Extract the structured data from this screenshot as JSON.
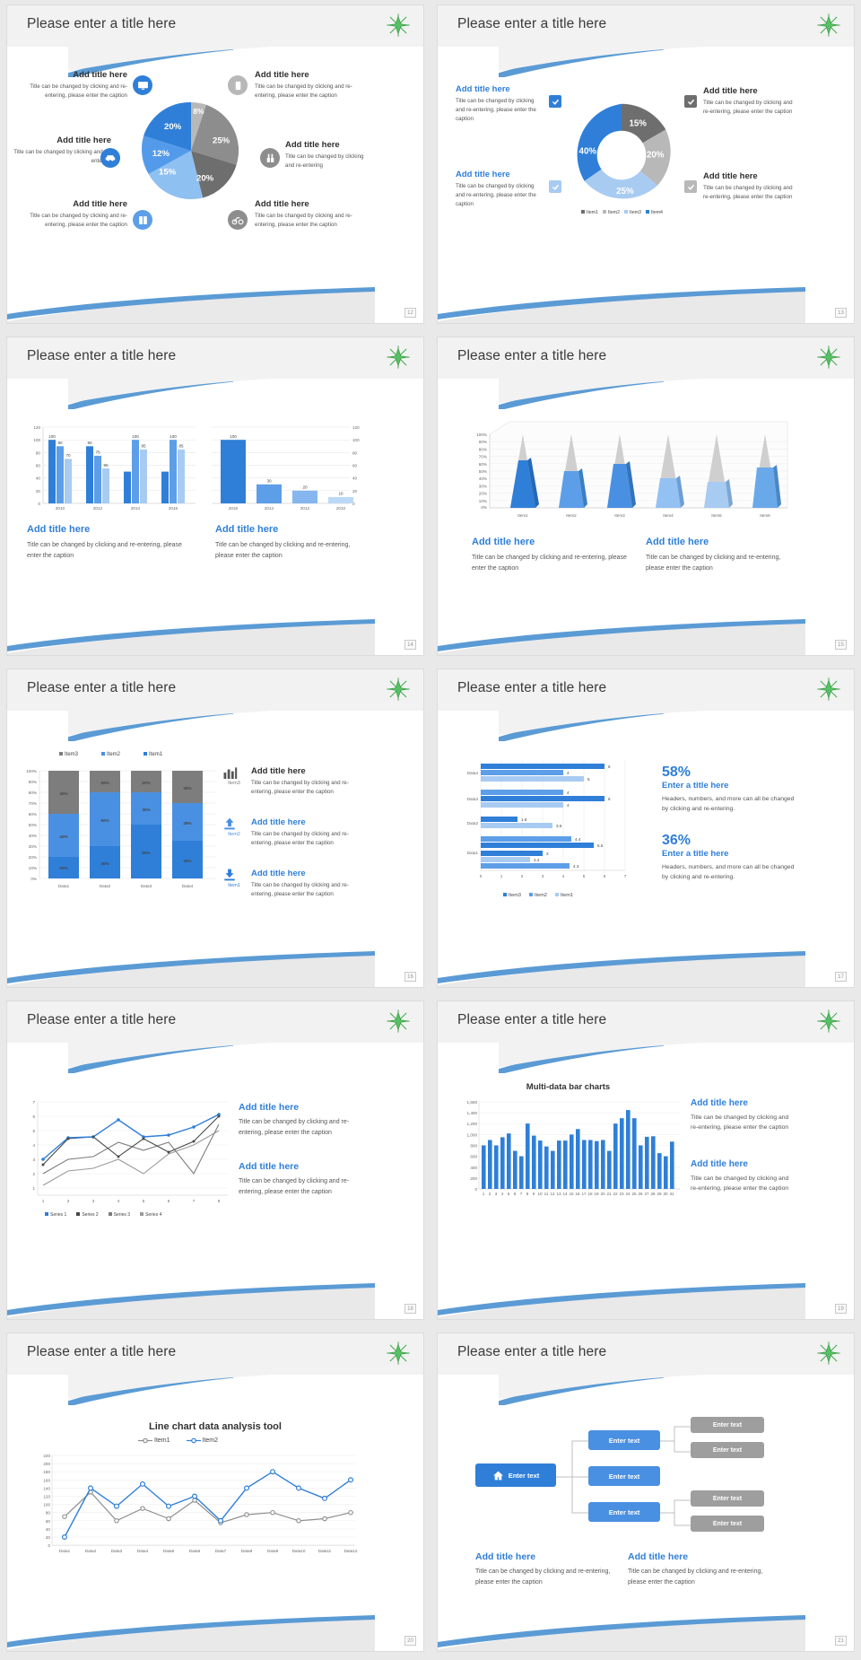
{
  "common": {
    "slide_title": "Please enter a title here",
    "add_title": "Add title here",
    "caption_long": "Title can be changed by clicking and re-entering, please enter the caption",
    "caption_mid": "Title can be changed by clicking and re-entering, please enter the caption",
    "caption_short": "Title can be changed by clicking and re-entering",
    "accent_blue": "#2f7fd8",
    "light_blue": "#6aa9e9",
    "pale_blue": "#a8cbf2",
    "grey_dark": "#6e6e6e",
    "grey_mid": "#8d8d8d",
    "grey_light": "#b8b8b8",
    "star_icon": "star-burst-icon"
  },
  "slides": [
    {
      "page": "12",
      "title": "Please enter a title here",
      "layout": "pie-six-callouts",
      "callouts": [
        {
          "title": "Add title here",
          "caption": "Title can be changed by clicking and re-entering, please enter the caption",
          "icon": "monitor-icon",
          "side": "left"
        },
        {
          "title": "Add title here",
          "caption": "Title can be changed by clicking and re-entering",
          "icon": "car-icon",
          "side": "left"
        },
        {
          "title": "Add title here",
          "caption": "Title can be changed by clicking and re-entering, please enter the caption",
          "icon": "book-icon",
          "side": "left"
        },
        {
          "title": "Add title here",
          "caption": "Title can be changed by clicking and re-entering, please enter the caption",
          "icon": "phone-icon",
          "side": "right"
        },
        {
          "title": "Add title here",
          "caption": "Title can be changed by clicking and re-entering",
          "icon": "binoculars-icon",
          "side": "right"
        },
        {
          "title": "Add title here",
          "caption": "Title can be changed by clicking and re-entering, please enter the caption",
          "icon": "bicycle-icon",
          "side": "right"
        }
      ],
      "chart_data": {
        "type": "pie",
        "title": "",
        "labels": [
          "20%",
          "12%",
          "15%",
          "20%",
          "25%",
          "8%"
        ],
        "values": [
          20,
          12,
          15,
          20,
          25,
          8
        ],
        "colors": [
          "#2f7fd8",
          "#539bea",
          "#8fc0f2",
          "#6e6e6e",
          "#8d8d8d",
          "#b8b8b8"
        ],
        "legend": "none"
      }
    },
    {
      "page": "13",
      "title": "Please enter a title here",
      "layout": "donut-four-callouts",
      "callouts": [
        {
          "title": "Add title here",
          "caption": "Title can be changed by clicking and re-entering, please enter the caption",
          "icon": "checkbox-checked-icon",
          "side": "left"
        },
        {
          "title": "Add title here",
          "caption": "Title can be changed by clicking and re-entering, please enter the caption",
          "icon": "checkbox-checked-icon",
          "side": "left"
        },
        {
          "title": "Add title here",
          "caption": "Title can be changed by clicking and re-entering, please enter the caption",
          "icon": "checkbox-checked-icon",
          "side": "right"
        },
        {
          "title": "Add title here",
          "caption": "Title can be changed by clicking and re-entering, please enter the caption",
          "icon": "checkbox-checked-icon",
          "side": "right"
        }
      ],
      "chart_data": {
        "type": "pie",
        "variant": "donut",
        "title": "",
        "categories": [
          "Item1",
          "Item2",
          "Item3",
          "Item4"
        ],
        "labels": [
          "15%",
          "20%",
          "25%",
          "40%"
        ],
        "values": [
          15,
          20,
          25,
          40
        ],
        "colors": [
          "#6e6e6e",
          "#b8b8b8",
          "#a8cbf2",
          "#2f7fd8"
        ],
        "legend": "bottom"
      }
    },
    {
      "page": "14",
      "title": "Please enter a title here",
      "layout": "two-column-bar",
      "columns": [
        {
          "title": "Add title here",
          "caption": "Title can be changed by clicking and re-entering, please enter the caption"
        },
        {
          "title": "Add title here",
          "caption": "Title can be changed by clicking and re-entering, please enter the caption"
        }
      ],
      "chart_data": [
        {
          "type": "bar",
          "title": "",
          "categories": [
            "2010",
            "2012",
            "2014",
            "2016"
          ],
          "ylim": [
            0,
            120
          ],
          "yticks": [
            0,
            20,
            40,
            60,
            80,
            100,
            120
          ],
          "series": [
            {
              "name": "Series 1",
              "values": [
                100,
                90,
                50,
                50
              ],
              "color": "#2f7fd8",
              "labels": [
                "100",
                "90",
                "",
                ""
              ]
            },
            {
              "name": "Series 2",
              "values": [
                90,
                75,
                100,
                100
              ],
              "color": "#5d9ee8",
              "labels": [
                "90",
                "75",
                "100",
                "100"
              ]
            },
            {
              "name": "Series 3",
              "values": [
                70,
                55,
                85,
                85
              ],
              "color": "#a8cbf2",
              "labels": [
                "70",
                "55",
                "85",
                "85"
              ]
            }
          ]
        },
        {
          "type": "bar",
          "title": "",
          "categories": [
            "2016",
            "2014",
            "2012",
            "2010"
          ],
          "values": [
            100,
            30,
            20,
            10
          ],
          "labels": [
            "100",
            "30",
            "20",
            "10"
          ],
          "ylim": [
            0,
            120
          ],
          "yticks": [
            0,
            20,
            40,
            60,
            80,
            100,
            120
          ],
          "colors": [
            "#2f7fd8",
            "#5d9ee8",
            "#85b6ef",
            "#bcd8f7"
          ]
        }
      ]
    },
    {
      "page": "15",
      "title": "Please enter a title here",
      "layout": "cone-3d-chart",
      "columns": [
        {
          "title": "Add title here",
          "caption": "Title can be changed by clicking and re-entering, please enter the caption"
        },
        {
          "title": "Add title here",
          "caption": "Title can be changed by clicking and re-entering, please enter the caption"
        }
      ],
      "chart_data": {
        "type": "bar",
        "variant": "3d-cone",
        "title": "",
        "categories": [
          "Item1",
          "Item2",
          "Item3",
          "Item4",
          "Item5",
          "Item6"
        ],
        "values": [
          72,
          50,
          60,
          42,
          38,
          65
        ],
        "ylim": [
          0,
          100
        ],
        "yticks": [
          "0%",
          "10%",
          "20%",
          "30%",
          "40%",
          "50%",
          "60%",
          "70%",
          "80%",
          "90%",
          "100%"
        ],
        "colors": [
          "#2f7fd8",
          "#5d9ee8",
          "#74aeee",
          "#93c1f3",
          "#a8cbf2",
          "#8fbbf0"
        ]
      }
    },
    {
      "page": "16",
      "title": "Please enter a title here",
      "layout": "stacked-100-bar",
      "items": [
        {
          "title": "Add title here",
          "caption": "Title can be changed by clicking and re-entering, please enter the caption",
          "icon": "bar-chart-icon",
          "tag": "Item3"
        },
        {
          "title": "Add title here",
          "caption": "Title can be changed by clicking and re-entering, please enter the caption",
          "icon": "upload-icon",
          "tag": "Item2"
        },
        {
          "title": "Add title here",
          "caption": "Title can be changed by clicking and re-entering, please enter the caption",
          "icon": "download-icon",
          "tag": "Item1"
        }
      ],
      "chart_data": {
        "type": "bar",
        "variant": "stacked-100",
        "title": "",
        "categories": [
          "Data1",
          "Data2",
          "Data3",
          "Data4"
        ],
        "yticks": [
          "0%",
          "10%",
          "20%",
          "30%",
          "40%",
          "50%",
          "60%",
          "70%",
          "80%",
          "90%",
          "100%"
        ],
        "series": [
          {
            "name": "Item1",
            "values": [
              20,
              30,
              50,
              35
            ],
            "labels": [
              "20%",
              "30%",
              "50%",
              "35%"
            ],
            "color": "#2f7fd8"
          },
          {
            "name": "Item2",
            "values": [
              40,
              50,
              30,
              35
            ],
            "labels": [
              "40%",
              "50%",
              "30%",
              "35%"
            ],
            "color": "#4a90e2"
          },
          {
            "name": "Item3",
            "values": [
              40,
              20,
              20,
              30
            ],
            "labels": [
              "40%",
              "20%",
              "20%",
              "30%"
            ],
            "color": "#7d7d7d"
          }
        ],
        "legend": [
          "Item3",
          "Item2",
          "Item1"
        ],
        "legend_position": "top"
      }
    },
    {
      "page": "17",
      "title": "Please enter a title here",
      "layout": "horizontal-bar-stats",
      "stats": [
        {
          "value": "58%",
          "title": "Enter a title here",
          "caption": "Headers, numbers, and more can all be changed by clicking and re-entering."
        },
        {
          "value": "36%",
          "title": "Enter a title here",
          "caption": "Headers, numbers, and more can all be changed by clicking and re-entering."
        }
      ],
      "chart_data": {
        "type": "bar",
        "variant": "horizontal-grouped",
        "title": "",
        "categories": [
          "Data1",
          "Data2",
          "Data3",
          "Data4"
        ],
        "xlim": [
          0,
          7
        ],
        "xticks": [
          0,
          1,
          2,
          3,
          4,
          5,
          6,
          7
        ],
        "series": [
          {
            "name": "Item1",
            "values": [
              4.3,
              3.5,
              4,
              5
            ],
            "labels": [
              "4.3",
              "3.5",
              "4",
              "5"
            ],
            "color": "#a8cbf2"
          },
          {
            "name": "Item2",
            "values": [
              2.4,
              1.8,
              4,
              4
            ],
            "labels": [
              "2.4",
              "1.8",
              "4",
              "4"
            ],
            "color": "#5d9ee8"
          },
          {
            "name": "Item3",
            "values": [
              5.5,
              4.4,
              6,
              6
            ],
            "labels": [
              "5.5",
              "4.4",
              "6",
              "6"
            ],
            "color": "#2f7fd8"
          }
        ],
        "legend": [
          "Item3",
          "Item2",
          "Item1"
        ],
        "legend_position": "bottom"
      }
    },
    {
      "page": "18",
      "title": "Please enter a title here",
      "layout": "multi-line-chart",
      "columns": [
        {
          "title": "Add title here",
          "caption": "Title can be changed by clicking and re-entering, please enter the caption"
        },
        {
          "title": "Add title here",
          "caption": "Title can be changed by clicking and re-entering, please enter the caption"
        }
      ],
      "chart_data": {
        "type": "line",
        "title": "",
        "x": [
          1,
          2,
          3,
          4,
          5,
          6,
          7,
          8
        ],
        "ylim": [
          0,
          7
        ],
        "yticks": [
          1,
          2,
          3,
          4,
          5,
          6,
          7
        ],
        "series": [
          {
            "name": "Series 1",
            "values": [
              3,
              4.5,
              4.6,
              5.8,
              4.6,
              4.7,
              5.3,
              6.3
            ],
            "color": "#2f7fd8"
          },
          {
            "name": "Series 2",
            "values": [
              2.6,
              4.4,
              4.5,
              3.2,
              4.4,
              3.5,
              4.2,
              6.2
            ],
            "color": "#4a4a4a"
          },
          {
            "name": "Series 3",
            "values": [
              1.2,
              2.2,
              2.4,
              3.0,
              2.0,
              3.4,
              4.0,
              5.0
            ],
            "color": "#7d7d7d"
          },
          {
            "name": "Series 4",
            "values": [
              2.0,
              3.0,
              3.2,
              4.2,
              3.6,
              4.2,
              2.0,
              5.4
            ],
            "color": "#9a9a9a"
          }
        ],
        "legend": [
          "Series 1",
          "Series 2",
          "Series 3",
          "Series 4"
        ],
        "legend_position": "bottom"
      }
    },
    {
      "page": "19",
      "title": "Please enter a title here",
      "layout": "multi-data-bar",
      "columns": [
        {
          "title": "Add title here",
          "caption": "Title can be changed by clicking and re-entering, please enter the caption"
        },
        {
          "title": "Add title here",
          "caption": "Title can be changed by clicking and re-entering, please enter the caption"
        }
      ],
      "chart_data": {
        "type": "bar",
        "title": "Multi-data bar charts",
        "categories": [
          "1",
          "2",
          "3",
          "4",
          "5",
          "6",
          "7",
          "8",
          "9",
          "10",
          "11",
          "12",
          "13",
          "14",
          "15",
          "16",
          "17",
          "18",
          "19",
          "20",
          "21",
          "22",
          "23",
          "24",
          "25",
          "26",
          "27",
          "28",
          "29",
          "30",
          "31"
        ],
        "values": [
          800,
          900,
          800,
          950,
          1020,
          700,
          600,
          1200,
          980,
          890,
          780,
          700,
          890,
          890,
          1000,
          1100,
          900,
          900,
          880,
          900,
          700,
          1200,
          1300,
          1450,
          1300,
          800,
          960,
          970,
          660,
          600,
          870
        ],
        "ylim": [
          0,
          1600
        ],
        "yticks": [
          "0",
          "200",
          "400",
          "600",
          "800",
          "1,000",
          "1,200",
          "1,400",
          "1,600"
        ],
        "color": "#2f7fd8"
      }
    },
    {
      "page": "20",
      "title": "Please enter a title here",
      "layout": "line-analysis-tool",
      "chart_data": {
        "type": "line",
        "title": "Line chart data analysis tool",
        "categories": [
          "Data1",
          "Data2",
          "Data3",
          "Data4",
          "Data5",
          "Data6",
          "Data7",
          "Data8",
          "Data9",
          "Data10",
          "Data11",
          "Data12"
        ],
        "ylim": [
          0,
          220
        ],
        "yticks": [
          "0",
          "20",
          "40",
          "60",
          "80",
          "100",
          "120",
          "140",
          "160",
          "180",
          "200",
          "220"
        ],
        "series": [
          {
            "name": "Item1",
            "values": [
              70,
              130,
              60,
              90,
              65,
              110,
              55,
              75,
              80,
              60,
              65,
              80
            ],
            "color": "#8d8d8d",
            "marker": "circle-open"
          },
          {
            "name": "Item2",
            "values": [
              20,
              140,
              95,
              150,
              95,
              120,
              60,
              140,
              180,
              140,
              115,
              160
            ],
            "color": "#2f7fd8",
            "marker": "circle-open"
          }
        ],
        "legend": [
          "Item1",
          "Item2"
        ],
        "legend_position": "top"
      }
    },
    {
      "page": "21",
      "title": "Please enter a title here",
      "layout": "flow-diagram",
      "flow": {
        "root": {
          "label": "Enter text",
          "icon": "home-icon",
          "color": "#2f7fd8"
        },
        "mid": [
          {
            "label": "Enter text",
            "color": "#4a90e2"
          },
          {
            "label": "Enter text",
            "color": "#4a90e2"
          },
          {
            "label": "Enter text",
            "color": "#4a90e2"
          }
        ],
        "leaves": [
          {
            "label": "Enter text",
            "color": "#9e9e9e"
          },
          {
            "label": "Enter text",
            "color": "#9e9e9e"
          },
          {
            "label": "Enter text",
            "color": "#9e9e9e"
          },
          {
            "label": "Enter text",
            "color": "#9e9e9e"
          }
        ]
      },
      "columns": [
        {
          "title": "Add title here",
          "caption": "Title can be changed by clicking and re-entering, please enter the caption"
        },
        {
          "title": "Add title here",
          "caption": "Title can be changed by clicking and re-entering, please enter the caption"
        }
      ]
    }
  ]
}
